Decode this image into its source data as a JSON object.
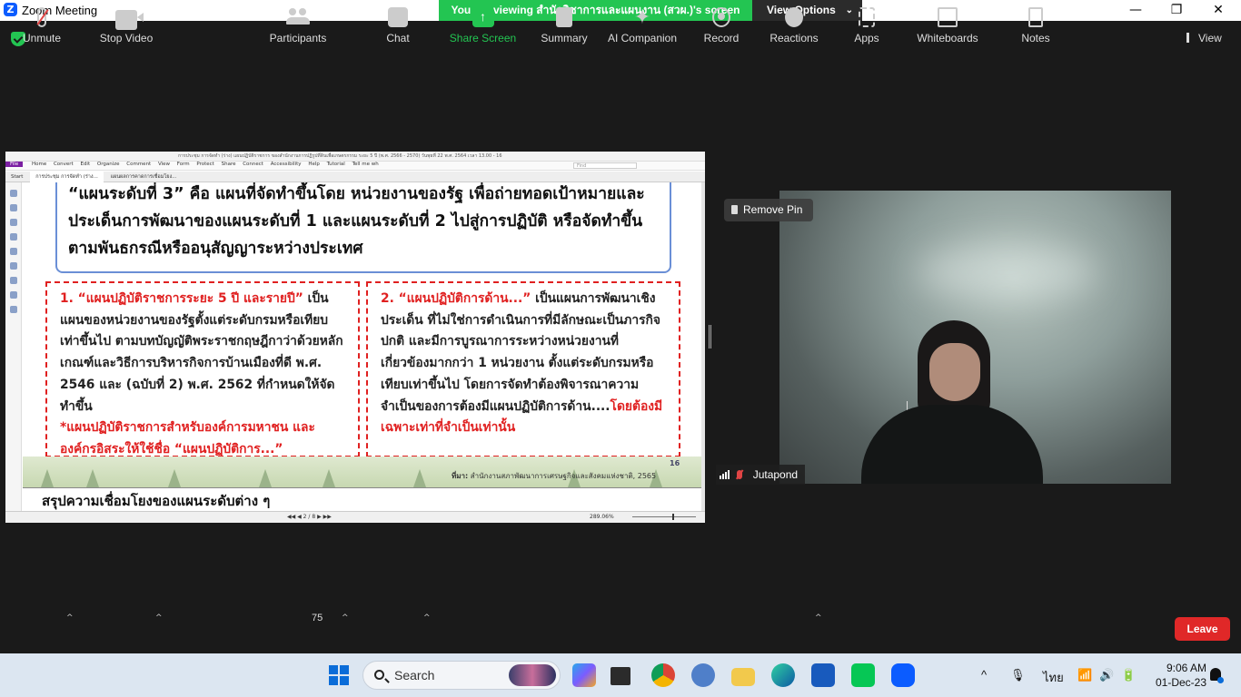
{
  "window": {
    "title": "Zoom Meeting",
    "app_icon": "Z",
    "minimize": "—",
    "restore": "❐",
    "close": "✕"
  },
  "banner": {
    "viewing_text": "You are viewing สำนักวิชาการและแผนงาน (สวผ.)'s screen",
    "view_options_label": "View Options"
  },
  "view_label": "View",
  "shared_screen": {
    "doc_title": "การประชุม การจัดทำ (ร่าง) แผนปฏิบัติราชการ ของสำนักงานการปฏิรูปที่ดินเพื่อเกษตรกรรม ระยะ 5 ปี (พ.ศ. 2566 - 2570) วันพุธที่ 22 พ.ศ. 2564 เวลา 13.00 - 16",
    "menu": [
      "File",
      "Home",
      "Convert",
      "Edit",
      "Organize",
      "Comment",
      "View",
      "Form",
      "Protect",
      "Share",
      "Connect",
      "Accessibility",
      "Help",
      "Tutorial",
      "Tell me wh"
    ],
    "find_placeholder": "Find",
    "tabs": [
      "Start",
      "การประชุม การจัดทำ (ร่าง...",
      "แผนผลการคาดการเชื่อมโยง..."
    ],
    "top_box_text": "“แผนระดับที่ 3” คือ แผนที่จัดทำขึ้นโดย หน่วยงานของรัฐ เพื่อถ่ายทอดเป้าหมายและประเด็นการพัฒนาของแผนระดับที่ 1 และแผนระดับที่ 2 ไปสู่การปฏิบัติ หรือจัดทำขึ้นตามพันธกรณีหรืออนุสัญญาระหว่างประเทศ",
    "left_box": {
      "heading": "1. “แผนปฏิบัติราชการระยะ 5 ปี และรายปี”",
      "body": " เป็นแผนของหน่วยงานของรัฐตั้งแต่ระดับกรมหรือเทียบเท่าขึ้นไป ตามบทบัญญัติพระราชกฤษฎีกาว่าด้วยหลักเกณฑ์และวิธีการบริหารกิจการบ้านเมืองที่ดี พ.ศ. 2546 และ (ฉบับที่ 2) พ.ศ. 2562 ที่กำหนดให้จัดทำขึ้น",
      "note": "*แผนปฏิบัติราชการสำหรับองค์การมหาชน และองค์กรอิสระให้ใช้ชื่อ “แผนปฏิบัติการ...”"
    },
    "right_box": {
      "heading": "2. “แผนปฏิบัติการด้าน...”",
      "body": " เป็นแผนการพัฒนาเชิงประเด็น ที่ไม่ใช่การดำเนินการที่มีลักษณะเป็นภารกิจปกติ และมีการบูรณาการระหว่างหน่วยงานที่เกี่ยวข้องมากกว่า 1 หน่วยงาน ตั้งแต่ระดับกรมหรือเทียบเท่าขึ้นไป โดยการจัดทำต้องพิจารณาความจำเป็นของการต้องมีแผนปฏิบัติการด้าน....",
      "emphasis": "โดยต้องมีเฉพาะเท่าที่จำเป็นเท่านั้น"
    },
    "source_label": "ที่มา:",
    "source_text": " สำนักงานสภาพัฒนาการเศรษฐกิจและสังคมแห่งชาติ, 2565",
    "slide_number": "16",
    "next_slide_title": "สรุปความเชื่อมโยงของแผนระดับต่าง ๆ",
    "page_indicator": "2 / 8",
    "zoom_level": "289.06%"
  },
  "video": {
    "remove_pin_label": "Remove Pin",
    "participant_name": "Jutapond"
  },
  "toolbar": {
    "unmute": "Unmute",
    "stop_video": "Stop Video",
    "participants": "Participants",
    "participants_count": "75",
    "chat": "Chat",
    "share_screen": "Share Screen",
    "summary": "Summary",
    "ai_companion": "AI Companion",
    "record": "Record",
    "reactions": "Reactions",
    "apps": "Apps",
    "whiteboards": "Whiteboards",
    "notes": "Notes",
    "leave": "Leave"
  },
  "taskbar": {
    "search_placeholder": "Search",
    "language": "ไทย",
    "time": "9:06 AM",
    "date": "01-Dec-23"
  },
  "colors": {
    "zoom_green": "#23c552",
    "zoom_blue": "#0b5cff",
    "leave_red": "#e02828",
    "slide_red": "#e02020"
  }
}
